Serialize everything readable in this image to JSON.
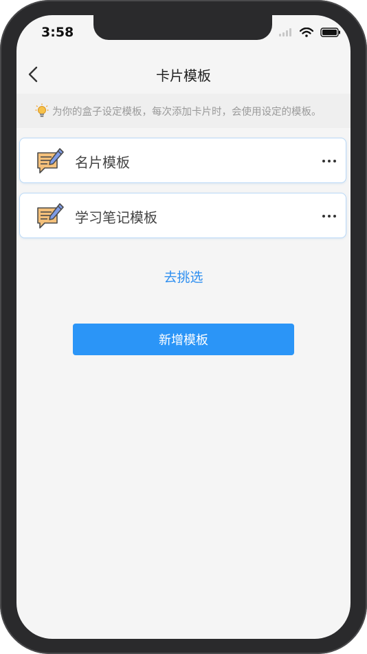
{
  "status_bar": {
    "time": "3:58"
  },
  "nav": {
    "title": "卡片模板"
  },
  "tip": {
    "text": "为你的盒子设定模板，每次添加卡片时，会使用设定的模板。"
  },
  "templates": [
    {
      "label": "名片模板"
    },
    {
      "label": "学习笔记模板"
    }
  ],
  "actions": {
    "pick_label": "去挑选",
    "add_label": "新增模板"
  },
  "colors": {
    "accent": "#2b95f7",
    "link": "#2d8ef0",
    "card_border": "#b9d8f6",
    "icon_fill": "#f4c07a"
  }
}
